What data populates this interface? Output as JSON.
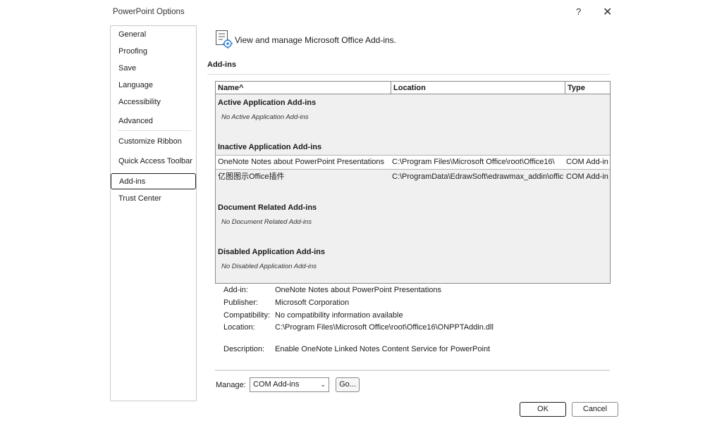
{
  "dialog": {
    "title": "PowerPoint Options",
    "help_label": "?",
    "close_label": "✕"
  },
  "sidebar": {
    "items": [
      {
        "label": "General"
      },
      {
        "label": "Proofing"
      },
      {
        "label": "Save"
      },
      {
        "label": "Language"
      },
      {
        "label": "Accessibility"
      },
      {
        "label": "Advanced"
      },
      {
        "label": "Customize Ribbon"
      },
      {
        "label": "Quick Access Toolbar"
      },
      {
        "label": "Add-ins",
        "selected": true
      },
      {
        "label": "Trust Center"
      }
    ]
  },
  "header": {
    "text": "View and manage Microsoft Office Add-ins.",
    "section_title": "Add-ins",
    "icon": "addins-gear-icon"
  },
  "table": {
    "columns": [
      "Name",
      "Location",
      "Type"
    ],
    "sort_indicator": "^",
    "groups": {
      "active": {
        "title": "Active Application Add-ins",
        "empty": "No Active Application Add-ins"
      },
      "inactive": {
        "title": "Inactive Application Add-ins",
        "rows": [
          {
            "name": "OneNote Notes about PowerPoint Presentations",
            "location": "C:\\Program Files\\Microsoft Office\\root\\Office16\\",
            "type": "COM Add-in",
            "selected": true
          },
          {
            "name": "亿图图示Office插件",
            "location": "C:\\ProgramData\\EdrawSoft\\edrawmax_addin\\offic",
            "type": "COM Add-in"
          }
        ]
      },
      "document": {
        "title": "Document Related Add-ins",
        "empty": "No Document Related Add-ins"
      },
      "disabled": {
        "title": "Disabled Application Add-ins",
        "empty": "No Disabled Application Add-ins"
      }
    }
  },
  "details": {
    "addin_label": "Add-in:",
    "addin_value": "OneNote Notes about PowerPoint Presentations",
    "publisher_label": "Publisher:",
    "publisher_value": "Microsoft Corporation",
    "compat_label": "Compatibility:",
    "compat_value": "No compatibility information available",
    "location_label": "Location:",
    "location_value": "C:\\Program Files\\Microsoft Office\\root\\Office16\\ONPPTAddin.dll",
    "description_label": "Description:",
    "description_value": "Enable OneNote Linked Notes Content Service for PowerPoint"
  },
  "manage": {
    "label": "Manage:",
    "selected": "COM Add-ins",
    "go_label": "Go..."
  },
  "buttons": {
    "ok": "OK",
    "cancel": "Cancel"
  }
}
